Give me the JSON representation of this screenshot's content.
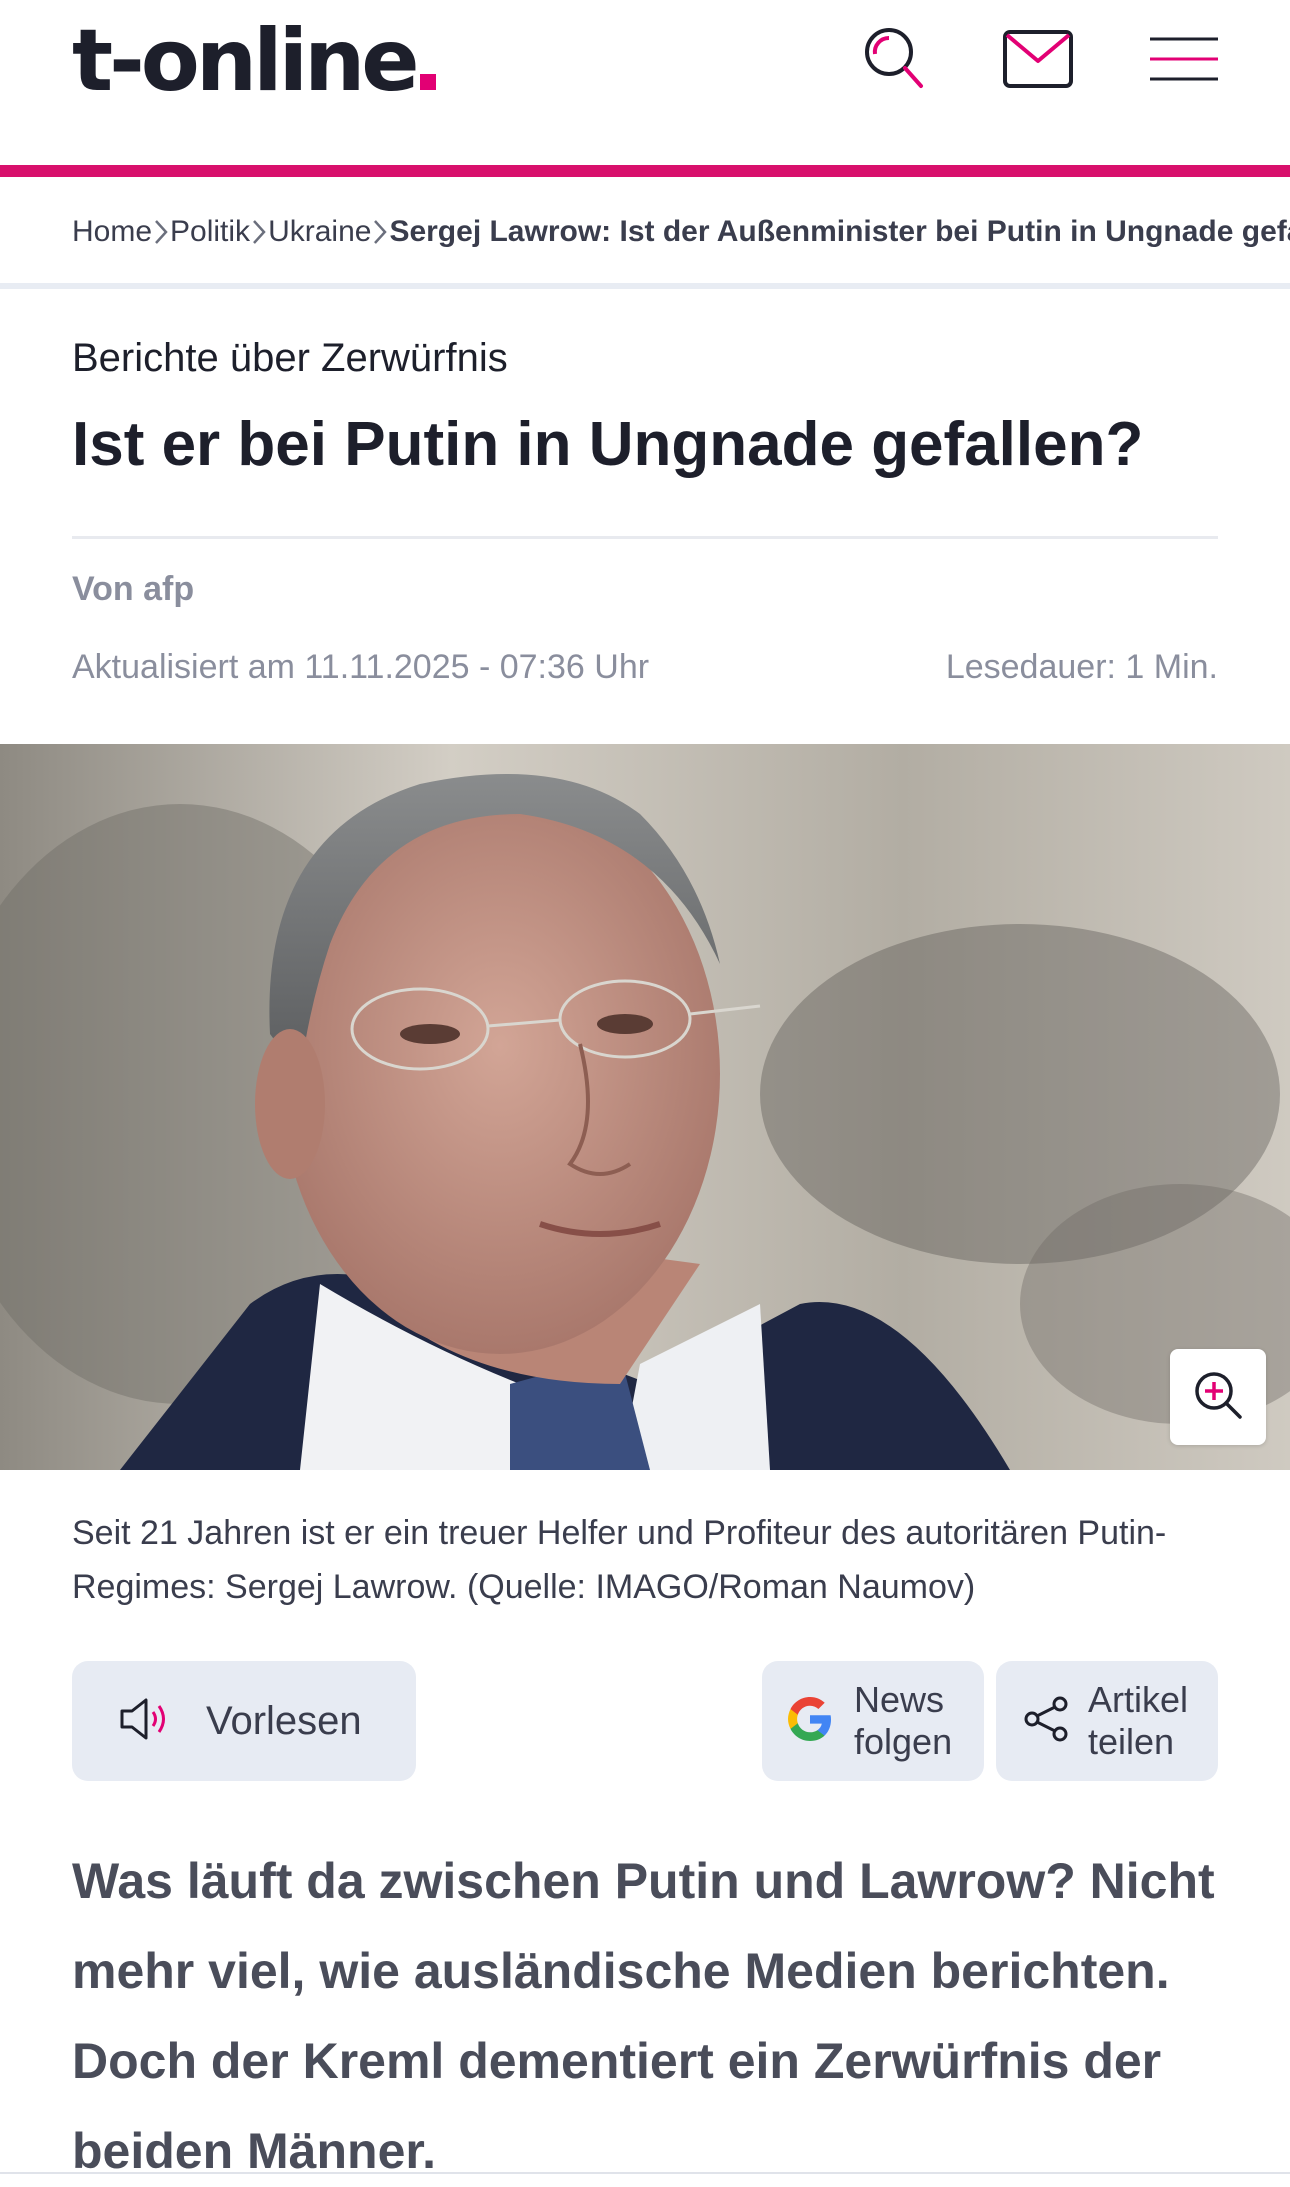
{
  "header": {
    "logo": "t-online",
    "icons": [
      "search-icon",
      "mail-icon",
      "menu-icon"
    ],
    "accent_color": "#e20074",
    "bar_color": "#d8106c"
  },
  "breadcrumb": {
    "items": [
      "Home",
      "Politik",
      "Ukraine"
    ],
    "current": "Sergej Lawrow: Ist der Außenminister bei Putin in Ungnade gefallen?"
  },
  "article": {
    "kicker": "Berichte über Zerwürfnis",
    "headline": "Ist er bei Putin in Ungnade gefallen?",
    "author": "Von afp",
    "updated": "Aktualisiert am 11.11.2025 - 07:36 Uhr",
    "read_time": "Lesedauer: 1 Min.",
    "caption": "Seit 21 Jahren ist er ein treuer Helfer und Profiteur des autoritären Putin-Regimes: Sergej Lawrow. (Quelle: IMAGO/Roman Naumov)",
    "lead": "Was läuft da zwischen Putin und Lawrow? Nicht mehr viel, wie ausländische Medien berichten. Doch der Kreml dementiert ein Zerwürfnis der beiden Männer."
  },
  "actions": {
    "read_aloud": "Vorlesen",
    "news_line1": "News",
    "news_line2": "folgen",
    "share_line1": "Artikel",
    "share_line2": "teilen"
  }
}
